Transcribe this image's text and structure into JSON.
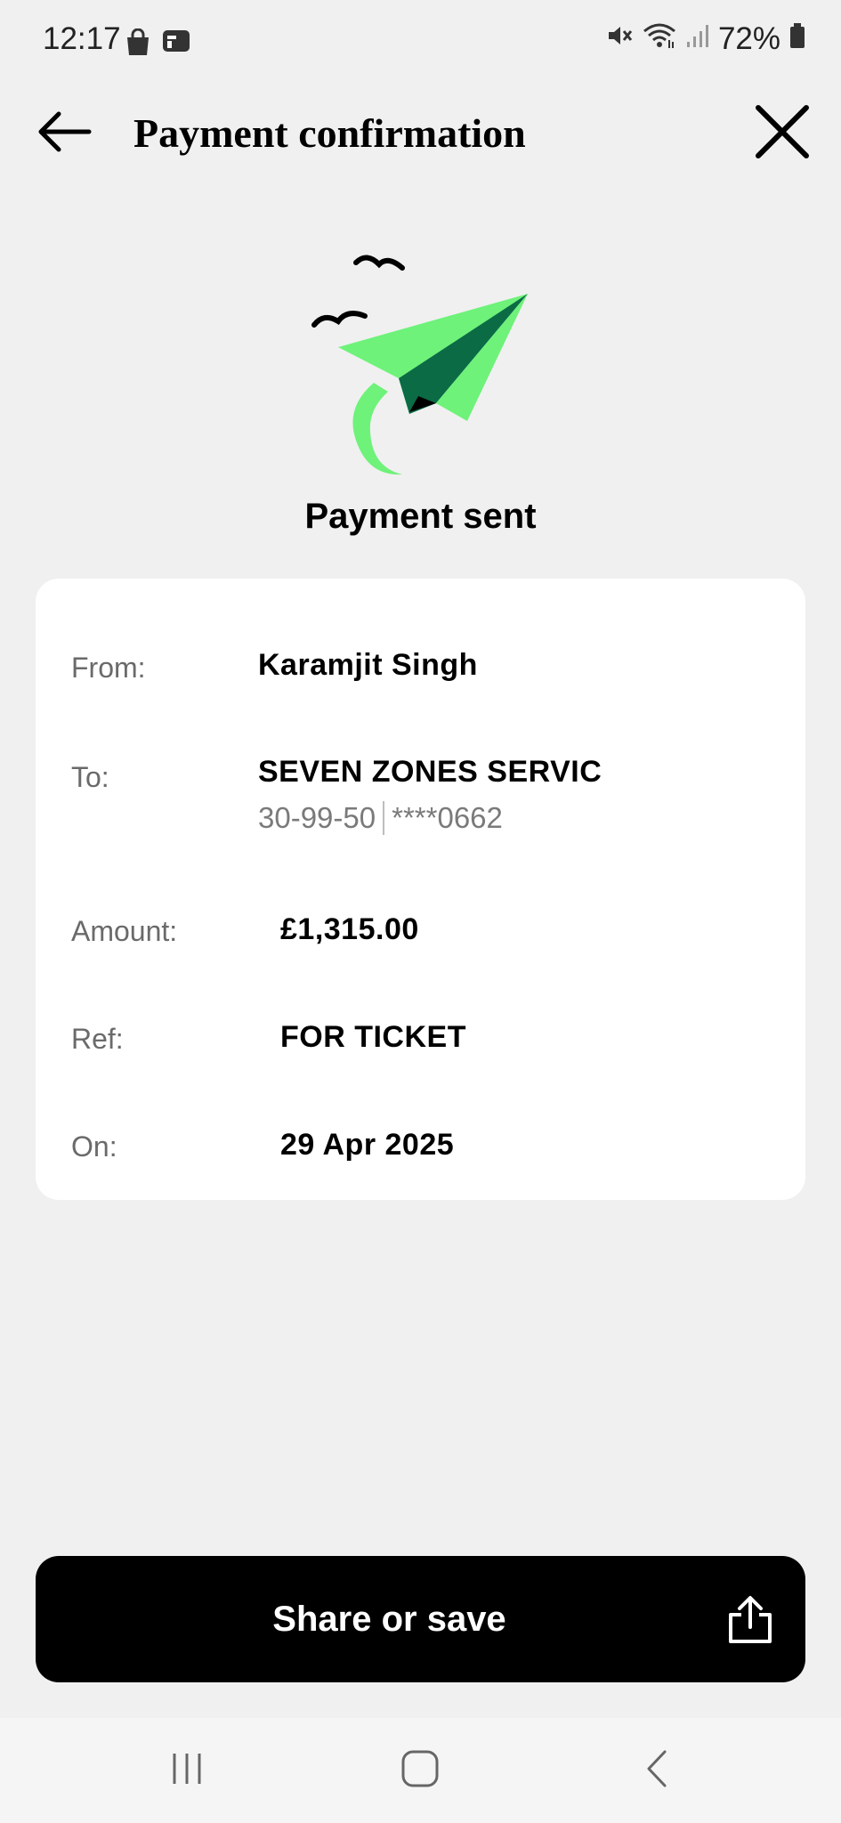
{
  "status_bar": {
    "time": "12:17",
    "battery": "72%",
    "icons": [
      "shopping-bag-icon",
      "card-icon",
      "mute-icon",
      "wifi-icon",
      "signal-icon",
      "battery-icon"
    ]
  },
  "header": {
    "title": "Payment confirmation",
    "back_icon": "arrow-left-icon",
    "close_icon": "close-icon"
  },
  "confirmation": {
    "title": "Payment sent",
    "illustration": "paper-plane-icon"
  },
  "details": {
    "from_label": "From:",
    "from_value": "Karamjit Singh",
    "to_label": "To:",
    "to_name": "SEVEN ZONES SERVIC",
    "to_sort_code": "30-99-50",
    "to_account": "****0662",
    "amount_label": "Amount:",
    "amount_value": "£1,315.00",
    "ref_label": "Ref:",
    "ref_value": "FOR TICKET",
    "on_label": "On:",
    "on_value": "29 Apr 2025"
  },
  "share": {
    "label": "Share or save",
    "icon": "share-icon"
  },
  "nav_bar": {
    "items": [
      "recent-apps-icon",
      "home-icon",
      "back-icon"
    ]
  },
  "colors": {
    "background": "#f0f0f0",
    "card": "#ffffff",
    "plane_light": "#6ef27a",
    "plane_dark": "#0b6b45",
    "button": "#000000"
  }
}
